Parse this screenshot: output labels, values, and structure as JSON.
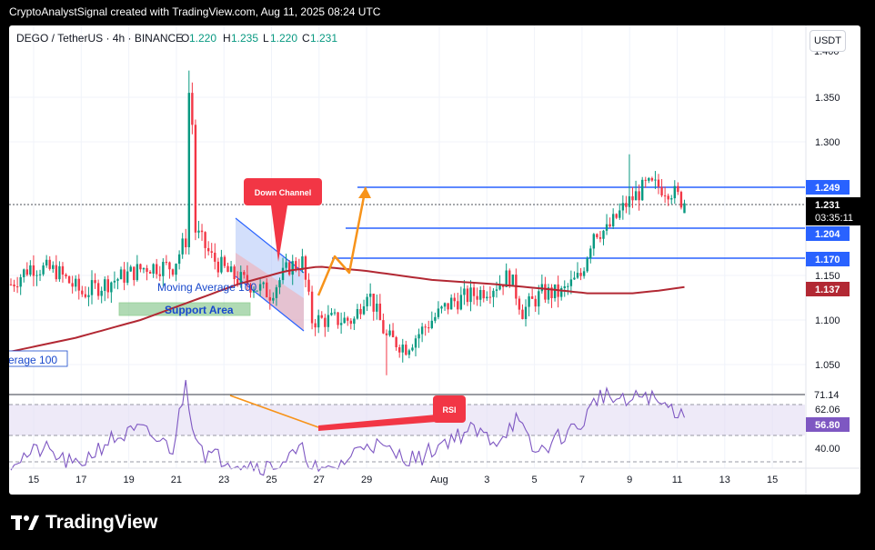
{
  "header_text": "CryptoAnalystSignal created with TradingView.com, Aug 11, 2025 08:24 UTC",
  "symbol": {
    "name": "DEGO / TetherUS · 4h · BINANCE",
    "o_label": "O",
    "o": "1.220",
    "h_label": "H",
    "h": "1.235",
    "l_label": "L",
    "l": "1.220",
    "c_label": "C",
    "c": "1.231"
  },
  "currency_button": "USDT",
  "brand": "TradingView",
  "colors": {
    "up": "#089981",
    "down": "#f23645",
    "level": "#2962ff",
    "ma": "#b22833",
    "rsi": "#7e57c2",
    "arrow": "#f7931a",
    "callout": "#f23645",
    "support": "#7dc383"
  },
  "annotations": {
    "down_channel": "Down Channel",
    "moving_average": "Moving Average 100",
    "support_area": "Support Area",
    "ma_left": "erage 100",
    "rsi": "RSI"
  },
  "price_labels": {
    "top_partial": "1.400",
    "current_price": "1.231",
    "countdown": "03:35:11",
    "level_1249": "1.249",
    "level_1204": "1.204",
    "level_1170": "1.170",
    "ma_value": "1.137",
    "rsi_value": "56.80",
    "rsi_top_partial": "71.14",
    "rsi_6206": "62.06",
    "rsi_40": "40.00"
  },
  "chart_data": {
    "type": "candlestick",
    "y_ticks": [
      1.05,
      1.1,
      1.15,
      1.3,
      1.35
    ],
    "ylim": [
      1.02,
      1.39
    ],
    "x_ticks": [
      "15",
      "17",
      "19",
      "21",
      "23",
      "25",
      "27",
      "29",
      "Aug",
      "3",
      "5",
      "7",
      "9",
      "11",
      "13",
      "15"
    ],
    "horizontal_levels": [
      1.249,
      1.204,
      1.17
    ],
    "moving_average_last": 1.137,
    "ohlc_last": {
      "open": 1.22,
      "high": 1.235,
      "low": 1.22,
      "close": 1.231
    },
    "rsi": {
      "last": 56.8,
      "levels": [
        62.06,
        40.0
      ]
    },
    "price_anchors": [
      [
        0,
        1.14
      ],
      [
        6,
        1.16
      ],
      [
        14,
        1.155
      ],
      [
        22,
        1.13
      ],
      [
        32,
        1.145
      ],
      [
        42,
        1.16
      ],
      [
        50,
        1.16
      ],
      [
        54,
        1.19
      ],
      [
        55,
        1.355
      ],
      [
        56,
        1.32
      ],
      [
        57,
        1.2
      ],
      [
        62,
        1.17
      ],
      [
        68,
        1.15
      ],
      [
        74,
        1.14
      ],
      [
        80,
        1.13
      ],
      [
        86,
        1.16
      ],
      [
        90,
        1.165
      ],
      [
        93,
        1.1
      ],
      [
        100,
        1.1
      ],
      [
        106,
        1.1
      ],
      [
        110,
        1.135
      ],
      [
        116,
        1.08
      ],
      [
        122,
        1.07
      ],
      [
        130,
        1.1
      ],
      [
        136,
        1.12
      ],
      [
        144,
        1.13
      ],
      [
        150,
        1.14
      ],
      [
        154,
        1.15
      ],
      [
        158,
        1.11
      ],
      [
        164,
        1.13
      ],
      [
        170,
        1.13
      ],
      [
        176,
        1.15
      ],
      [
        180,
        1.2
      ],
      [
        184,
        1.2
      ],
      [
        190,
        1.23
      ],
      [
        196,
        1.25
      ],
      [
        200,
        1.25
      ],
      [
        204,
        1.245
      ],
      [
        208,
        1.231
      ]
    ],
    "ma_anchors": [
      [
        -6,
        1.06
      ],
      [
        20,
        1.08
      ],
      [
        40,
        1.1
      ],
      [
        55,
        1.12
      ],
      [
        70,
        1.14
      ],
      [
        85,
        1.155
      ],
      [
        95,
        1.16
      ],
      [
        110,
        1.155
      ],
      [
        130,
        1.145
      ],
      [
        150,
        1.14
      ],
      [
        165,
        1.135
      ],
      [
        178,
        1.13
      ],
      [
        192,
        1.13
      ],
      [
        200,
        1.133
      ],
      [
        208,
        1.137
      ]
    ],
    "rsi_anchors": [
      [
        0,
        40
      ],
      [
        10,
        45
      ],
      [
        20,
        38
      ],
      [
        30,
        48
      ],
      [
        40,
        52
      ],
      [
        50,
        45
      ],
      [
        54,
        70
      ],
      [
        56,
        55
      ],
      [
        60,
        43
      ],
      [
        70,
        40
      ],
      [
        80,
        38
      ],
      [
        90,
        44
      ],
      [
        96,
        35
      ],
      [
        104,
        41
      ],
      [
        110,
        48
      ],
      [
        118,
        43
      ],
      [
        126,
        41
      ],
      [
        134,
        48
      ],
      [
        142,
        52
      ],
      [
        150,
        48
      ],
      [
        156,
        56
      ],
      [
        162,
        43
      ],
      [
        170,
        50
      ],
      [
        176,
        54
      ],
      [
        182,
        66
      ],
      [
        190,
        62
      ],
      [
        196,
        66
      ],
      [
        200,
        62
      ],
      [
        205,
        60
      ],
      [
        208,
        56.8
      ]
    ]
  }
}
